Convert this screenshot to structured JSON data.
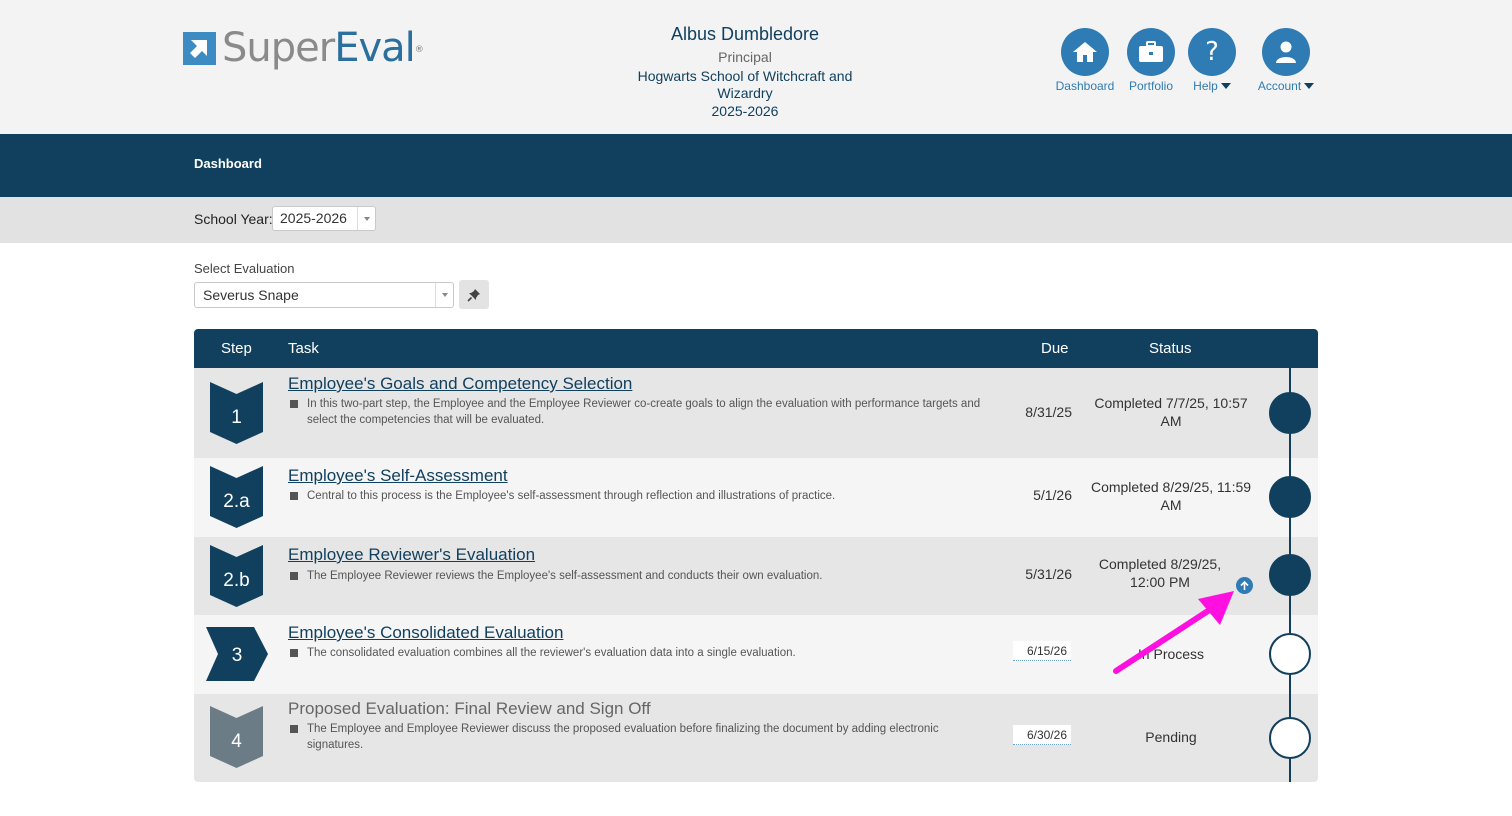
{
  "header": {
    "logo": {
      "super": "Super",
      "eval": "Eval",
      "reg": "®"
    },
    "user": {
      "name": "Albus Dumbledore",
      "role": "Principal",
      "school": "Hogwarts School of Witchcraft and Wizardry",
      "year": "2025-2026"
    },
    "nav": [
      {
        "label": "Dashboard",
        "icon": "home-icon"
      },
      {
        "label": "Portfolio",
        "icon": "briefcase-icon"
      },
      {
        "label": "Help",
        "icon": "question-icon"
      },
      {
        "label": "Account",
        "icon": "user-icon"
      }
    ]
  },
  "bluebar": {
    "active": "Dashboard"
  },
  "school_year": {
    "label": "School Year:",
    "value": "2025-2026"
  },
  "select_evaluation": {
    "label": "Select Evaluation",
    "value": "Severus Snape",
    "pin_icon": "pin-icon"
  },
  "table": {
    "headers": {
      "step": "Step",
      "task": "Task",
      "due": "Due",
      "status": "Status"
    },
    "rows": [
      {
        "step": "1",
        "title": "Employee's Goals and Competency Selection",
        "desc": "In this two-part step, the Employee and the Employee Reviewer co-create goals to align the evaluation with performance targets and select the competencies that will be evaluated.",
        "due": "8/31/25",
        "status": "Completed 7/7/25, 10:57 AM"
      },
      {
        "step": "2.a",
        "title": "Employee's Self-Assessment",
        "desc": "Central to this process is the Employee's self-assessment through reflection and illustrations of practice.",
        "due": "5/1/26",
        "status": "Completed 8/29/25, 11:59 AM"
      },
      {
        "step": "2.b",
        "title": "Employee Reviewer's Evaluation",
        "desc": "The Employee Reviewer reviews the Employee's self-assessment and conducts their own evaluation.",
        "due": "5/31/26",
        "status": "Completed 8/29/25, 12:00 PM"
      },
      {
        "step": "3",
        "title": "Employee's Consolidated Evaluation",
        "desc": "The consolidated evaluation combines all the reviewer's evaluation data into a single evaluation.",
        "due": "6/15/26",
        "status": "In Process"
      },
      {
        "step": "4",
        "title": "Proposed Evaluation: Final Review and Sign Off",
        "desc": "The Employee and Employee Reviewer discuss the proposed evaluation before finalizing the document by adding electronic signatures.",
        "due": "6/30/26",
        "status": "Pending"
      }
    ]
  },
  "colors": {
    "navy": "#11405e",
    "accent": "#2f7bb3",
    "arrow": "#ff00e0"
  }
}
